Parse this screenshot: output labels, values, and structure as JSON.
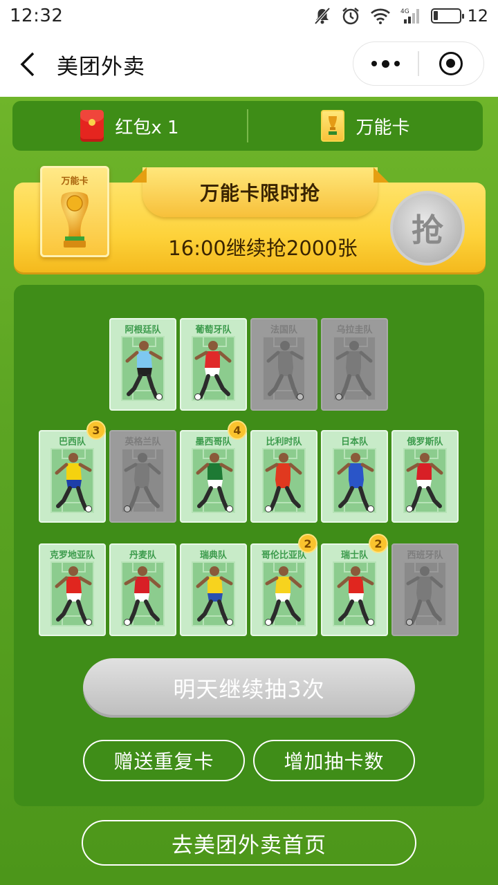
{
  "status": {
    "time": "12:32",
    "battery_text": "12"
  },
  "nav": {
    "title": "美团外卖"
  },
  "topbar": {
    "redpacket_label": "红包x 1",
    "wildcard_label": "万能卡"
  },
  "banner": {
    "card_label": "万能卡",
    "title": "万能卡限时抢",
    "subtitle": "16:00继续抢2000张",
    "grab_label": "抢"
  },
  "cards": [
    {
      "name": "阿根廷队",
      "owned": true,
      "count": "",
      "jersey": "#7ec8f0",
      "shorts": "#222222"
    },
    {
      "name": "葡萄牙队",
      "owned": true,
      "count": "",
      "jersey": "#e02a2a",
      "shorts": "#ffffff"
    },
    {
      "name": "法国队",
      "owned": false,
      "count": "",
      "jersey": "#7a7a7a",
      "shorts": "#7a7a7a"
    },
    {
      "name": "乌拉圭队",
      "owned": false,
      "count": "",
      "jersey": "#7a7a7a",
      "shorts": "#7a7a7a"
    },
    {
      "name": "巴西队",
      "owned": true,
      "count": "3",
      "jersey": "#f5d20f",
      "shorts": "#1f3fa8"
    },
    {
      "name": "英格兰队",
      "owned": false,
      "count": "",
      "jersey": "#7a7a7a",
      "shorts": "#7a7a7a"
    },
    {
      "name": "墨西哥队",
      "owned": true,
      "count": "4",
      "jersey": "#1e7a34",
      "shorts": "#ffffff"
    },
    {
      "name": "比利时队",
      "owned": true,
      "count": "",
      "jersey": "#e0391f",
      "shorts": "#e0391f"
    },
    {
      "name": "日本队",
      "owned": true,
      "count": "",
      "jersey": "#2a55c8",
      "shorts": "#2a55c8"
    },
    {
      "name": "俄罗斯队",
      "owned": true,
      "count": "",
      "jersey": "#d81f26",
      "shorts": "#ffffff"
    },
    {
      "name": "克罗地亚队",
      "owned": true,
      "count": "",
      "jersey": "#e0261f",
      "shorts": "#ffffff"
    },
    {
      "name": "丹麦队",
      "owned": true,
      "count": "",
      "jersey": "#d81f26",
      "shorts": "#ffffff"
    },
    {
      "name": "瑞典队",
      "owned": true,
      "count": "",
      "jersey": "#f7d31e",
      "shorts": "#2b4fb0"
    },
    {
      "name": "哥伦比亚队",
      "owned": true,
      "count": "2",
      "jersey": "#f7d31e",
      "shorts": "#ffffff"
    },
    {
      "name": "瑞士队",
      "owned": true,
      "count": "2",
      "jersey": "#e0261f",
      "shorts": "#ffffff"
    },
    {
      "name": "西班牙队",
      "owned": false,
      "count": "",
      "jersey": "#7a7a7a",
      "shorts": "#7a7a7a"
    }
  ],
  "buttons": {
    "draw": "明天继续抽3次",
    "gift": "赠送重复卡",
    "add": "增加抽卡数",
    "home": "去美团外卖首页"
  }
}
